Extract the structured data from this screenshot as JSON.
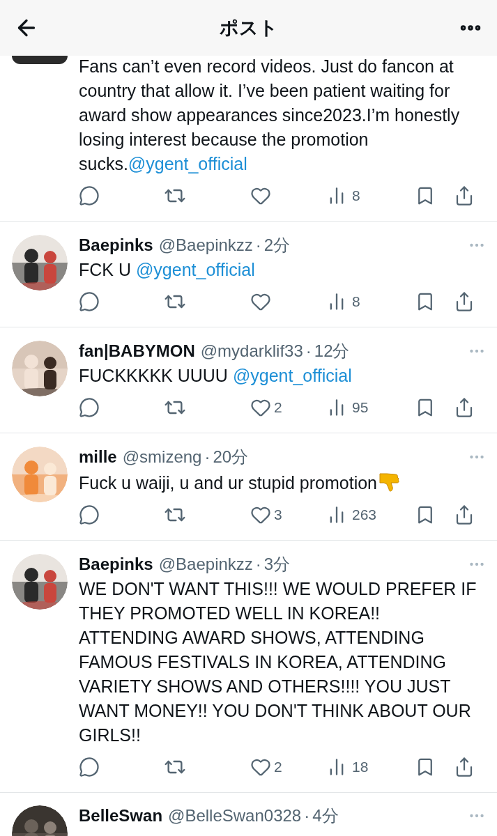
{
  "header": {
    "title": "ポスト"
  },
  "meta_separator": "·",
  "tweets": [
    {
      "text": [
        {
          "kind": "plain",
          "text": "Fans can’t even record videos. Just do fancon at country that allow it. I’ve been patient waiting for award show appearances since2023.I’m honestly losing interest because the promotion sucks."
        },
        {
          "kind": "mention",
          "text": "@ygent_official"
        }
      ],
      "actions": {
        "views": "8"
      }
    },
    {
      "name": "Baepinks",
      "handle": "@Baepinkzz",
      "time": "2分",
      "text": [
        {
          "kind": "plain",
          "text": "FCK U "
        },
        {
          "kind": "mention",
          "text": "@ygent_official"
        }
      ],
      "actions": {
        "views": "8"
      }
    },
    {
      "name": "fan|BABYMON",
      "handle": "@mydarklif33",
      "time": "12分",
      "text": [
        {
          "kind": "plain",
          "text": "FUCKKKKK UUUU "
        },
        {
          "kind": "mention",
          "text": "@ygent_official"
        }
      ],
      "actions": {
        "likes": "2",
        "views": "95"
      }
    },
    {
      "name": "mille",
      "handle": "@smizeng",
      "time": "20分",
      "text": [
        {
          "kind": "plain",
          "text": "Fuck u waiji, u and ur stupid promotion"
        },
        {
          "kind": "emoji-thumbs-down"
        }
      ],
      "actions": {
        "likes": "3",
        "views": "263"
      }
    },
    {
      "name": "Baepinks",
      "handle": "@Baepinkzz",
      "time": "3分",
      "text": [
        {
          "kind": "plain",
          "text": "WE DON'T WANT THIS!!! WE WOULD PREFER IF THEY PROMOTED WELL IN KOREA!! ATTENDING AWARD SHOWS, ATTENDING FAMOUS FESTIVALS IN KOREA, ATTENDING VARIETY SHOWS AND OTHERS!!!! YOU JUST WANT MONEY!! YOU DON'T THINK ABOUT OUR GIRLS!!"
        }
      ],
      "actions": {
        "likes": "2",
        "views": "18"
      }
    },
    {
      "name": "BelleSwan",
      "handle": "@BelleSwan0328",
      "time": "4分"
    }
  ]
}
